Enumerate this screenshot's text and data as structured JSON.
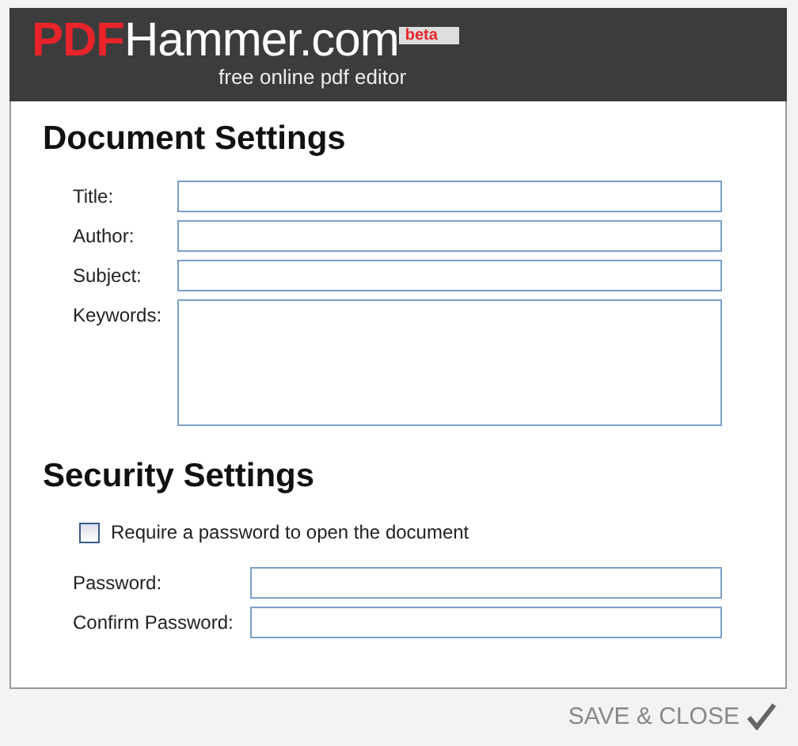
{
  "header": {
    "logo_accent": "PDF",
    "logo_main": "Hammer.com",
    "badge": "beta",
    "tagline": "free online pdf editor"
  },
  "document_settings": {
    "heading": "Document Settings",
    "fields": [
      {
        "label": "Title:",
        "kind": "line"
      },
      {
        "label": "Author:",
        "kind": "line"
      },
      {
        "label": "Subject:",
        "kind": "line"
      },
      {
        "label": "Keywords:",
        "kind": "area"
      }
    ]
  },
  "security_settings": {
    "heading": "Security Settings",
    "checkbox": {
      "label": "Require a password to open the document",
      "checked": false
    },
    "fields": [
      {
        "label": "Password:",
        "kind": "line"
      },
      {
        "label": "Confirm Password:",
        "kind": "line"
      }
    ]
  },
  "footer": {
    "button": "SAVE & CLOSE"
  }
}
